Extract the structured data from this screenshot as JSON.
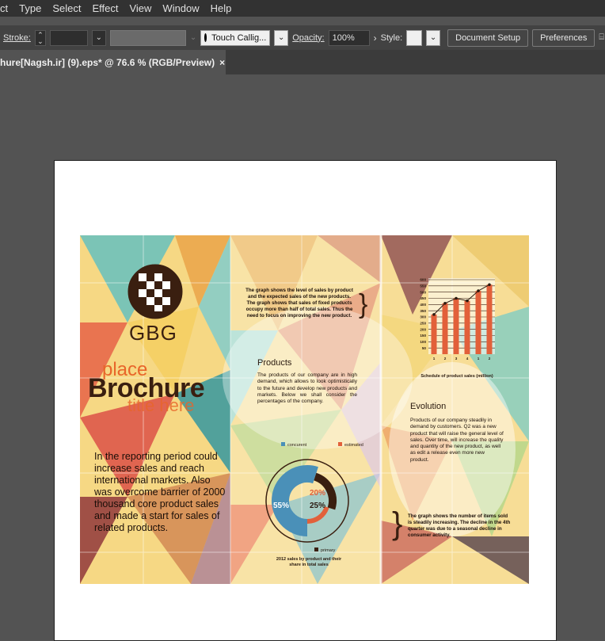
{
  "menubar": {
    "items": [
      "ct",
      "Type",
      "Select",
      "Effect",
      "View",
      "Window",
      "Help"
    ]
  },
  "control_bar": {
    "stroke_label": "Stroke:",
    "brush_name": "Touch Callig...",
    "opacity_label": "Opacity:",
    "opacity_value": "100%",
    "style_label": "Style:",
    "doc_setup_label": "Document Setup",
    "preferences_label": "Preferences"
  },
  "document_tab": {
    "title": "hure[Nagsh.ir] (9).eps* @ 76.6 % (RGB/Preview)",
    "close_glyph": "×"
  },
  "brochure": {
    "logo_text": "GBG",
    "title_small": "place",
    "title_big": "Brochure",
    "title_sub": "title here",
    "left_body": "In the reporting period could increase sales and reach international markets. Also was overcome barrier of 2000 thousand core product sales and made a start for sales of related products.",
    "mid_intro": "The graph shows the level of sales by product and the expected sales of the new products. The graph shows that sales of fixed products occupy more than half of total sales. Thus the need to focus on improving the new product.",
    "products_heading": "Products",
    "products_body": "The products of our company are in high demand, which allows to look optimistically to the future and develop new products and markets. Below we shall consider the percentages of the company.",
    "legend_concurrent": "concurent",
    "legend_estimated": "estimated",
    "legend_primary": "primary",
    "pct_55": "55%",
    "pct_20": "20%",
    "pct_25": "25%",
    "donut_caption": "2012 sales by product and their share in total sales",
    "bar_caption": "Schedule of product sales (million)",
    "evolution_heading": "Evolution",
    "evolution_body": "Products of our company steadily in demand by customers. Q2 was a new product that will raise the general level of sales. Over time, will increase the quality and quantity of the new product, as well as edit a release even more new product.",
    "right_bottom": "The graph shows the number of items sold is steadily increasing. The decline in the 4th quarter was due to a seasonal decline in consumer activity."
  },
  "chart_data": [
    {
      "type": "bar",
      "categories": [
        "1",
        "2",
        "3",
        "4",
        "1",
        "2"
      ],
      "values": [
        320,
        410,
        450,
        430,
        510,
        560
      ],
      "ylim": [
        0,
        600
      ],
      "yticks": [
        50,
        100,
        150,
        200,
        250,
        300,
        350,
        400,
        450,
        500,
        550,
        600
      ],
      "title": "Schedule of product sales (million)"
    },
    {
      "type": "pie",
      "labels": [
        "55%",
        "25%",
        "20%"
      ],
      "values": [
        55,
        25,
        20
      ]
    }
  ],
  "colors": {
    "menubar": "#323232",
    "controlbar": "#424242",
    "canvas": "#535353",
    "bar_orange": "#e2603a",
    "title_orange": "#e8652a",
    "title_brown": "#3a1f10"
  }
}
